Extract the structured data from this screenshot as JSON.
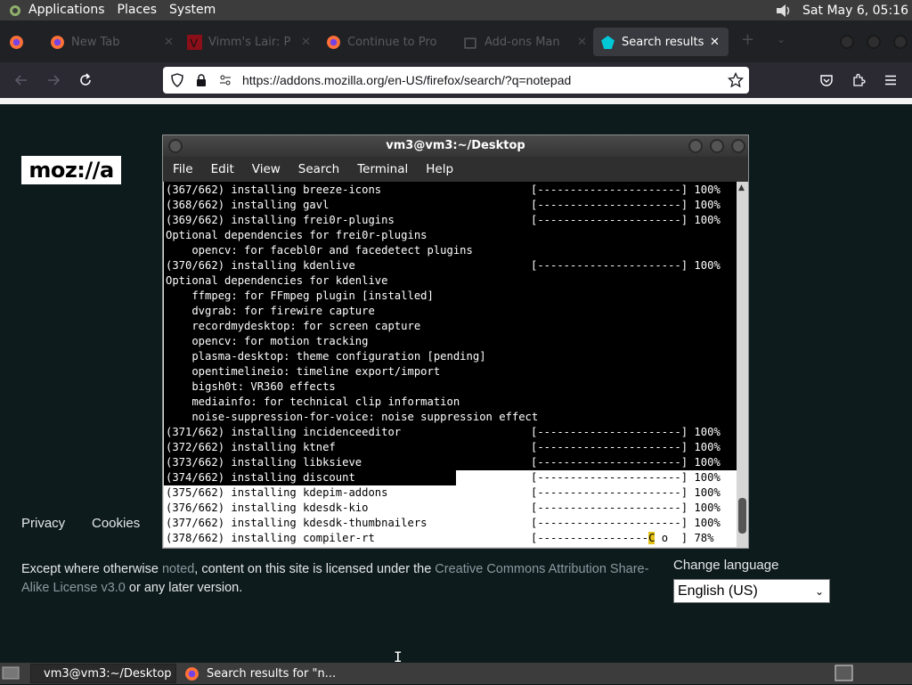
{
  "top_panel": {
    "menus": [
      "Applications",
      "Places",
      "System"
    ],
    "clock": "Sat May  6, 05:16"
  },
  "browser": {
    "tabs": [
      {
        "title": "",
        "icon": "firefox-icon"
      },
      {
        "title": "New Tab",
        "icon": "firefox-icon"
      },
      {
        "title": "Vimm's Lair: P",
        "icon": "vimm-icon"
      },
      {
        "title": "Continue to Pro",
        "icon": "firefox-icon"
      },
      {
        "title": "Add-ons Man",
        "icon": "puzzle-icon"
      },
      {
        "title": "Search results f",
        "icon": "addons-icon"
      }
    ],
    "url": "https://addons.mozilla.org/en-US/firefox/search/?q=notepad"
  },
  "page": {
    "logo": "moz://a",
    "footer_links": [
      "Privacy",
      "Cookies"
    ],
    "license_parts": {
      "p1": "Except where otherwise ",
      "noted": "noted",
      "p2": ", content on this site is licensed under the ",
      "cc": "Creative Commons Attribution Share-Alike License v3.0",
      "p3": " or any later version."
    },
    "change_language": "Change language",
    "language": "English (US)"
  },
  "terminal": {
    "title": "vm3@vm3:~/Desktop",
    "menu": [
      "File",
      "Edit",
      "View",
      "Search",
      "Terminal",
      "Help"
    ],
    "lines": [
      {
        "text": "(367/662) installing breeze-icons",
        "bar": "[----------------------] 100%"
      },
      {
        "text": "(368/662) installing gavl",
        "bar": "[----------------------] 100%"
      },
      {
        "text": "(369/662) installing frei0r-plugins",
        "bar": "[----------------------] 100%"
      },
      {
        "text": "Optional dependencies for frei0r-plugins",
        "bar": ""
      },
      {
        "text": "    opencv: for facebl0r and facedetect plugins",
        "bar": ""
      },
      {
        "text": "(370/662) installing kdenlive",
        "bar": "[----------------------] 100%"
      },
      {
        "text": "Optional dependencies for kdenlive",
        "bar": ""
      },
      {
        "text": "    ffmpeg: for FFmpeg plugin [installed]",
        "bar": ""
      },
      {
        "text": "    dvgrab: for firewire capture",
        "bar": ""
      },
      {
        "text": "    recordmydesktop: for screen capture",
        "bar": ""
      },
      {
        "text": "    opencv: for motion tracking",
        "bar": ""
      },
      {
        "text": "    plasma-desktop: theme configuration [pending]",
        "bar": ""
      },
      {
        "text": "    opentimelineio: timeline export/import",
        "bar": ""
      },
      {
        "text": "    bigsh0t: VR360 effects",
        "bar": ""
      },
      {
        "text": "    mediainfo: for technical clip information",
        "bar": ""
      },
      {
        "text": "    noise-suppression-for-voice: noise suppression effect",
        "bar": ""
      },
      {
        "text": "(371/662) installing incidenceeditor",
        "bar": "[----------------------] 100%"
      },
      {
        "text": "(372/662) installing ktnef",
        "bar": "[----------------------] 100%"
      },
      {
        "text": "(373/662) installing libksieve",
        "bar": "[----------------------] 100%"
      },
      {
        "text": "(374/662) installing discount",
        "bar": "[----------------------] 100%"
      },
      {
        "text": "(375/662) installing kdepim-addons",
        "bar": "[----------------------] 100%"
      },
      {
        "text": "(376/662) installing kdesdk-kio",
        "bar": "[----------------------] 100%"
      },
      {
        "text": "(377/662) installing kdesdk-thumbnailers",
        "bar": "[----------------------] 100%"
      }
    ],
    "last_line": {
      "text": "(378/662) installing compiler-rt",
      "bar_start": "[-----------------",
      "cursor": "C",
      "bar_end": " o  ] ",
      "pct": "78%"
    }
  },
  "taskbar": {
    "tasks": [
      "vm3@vm3:~/Desktop",
      "Search results for \"n..."
    ]
  }
}
